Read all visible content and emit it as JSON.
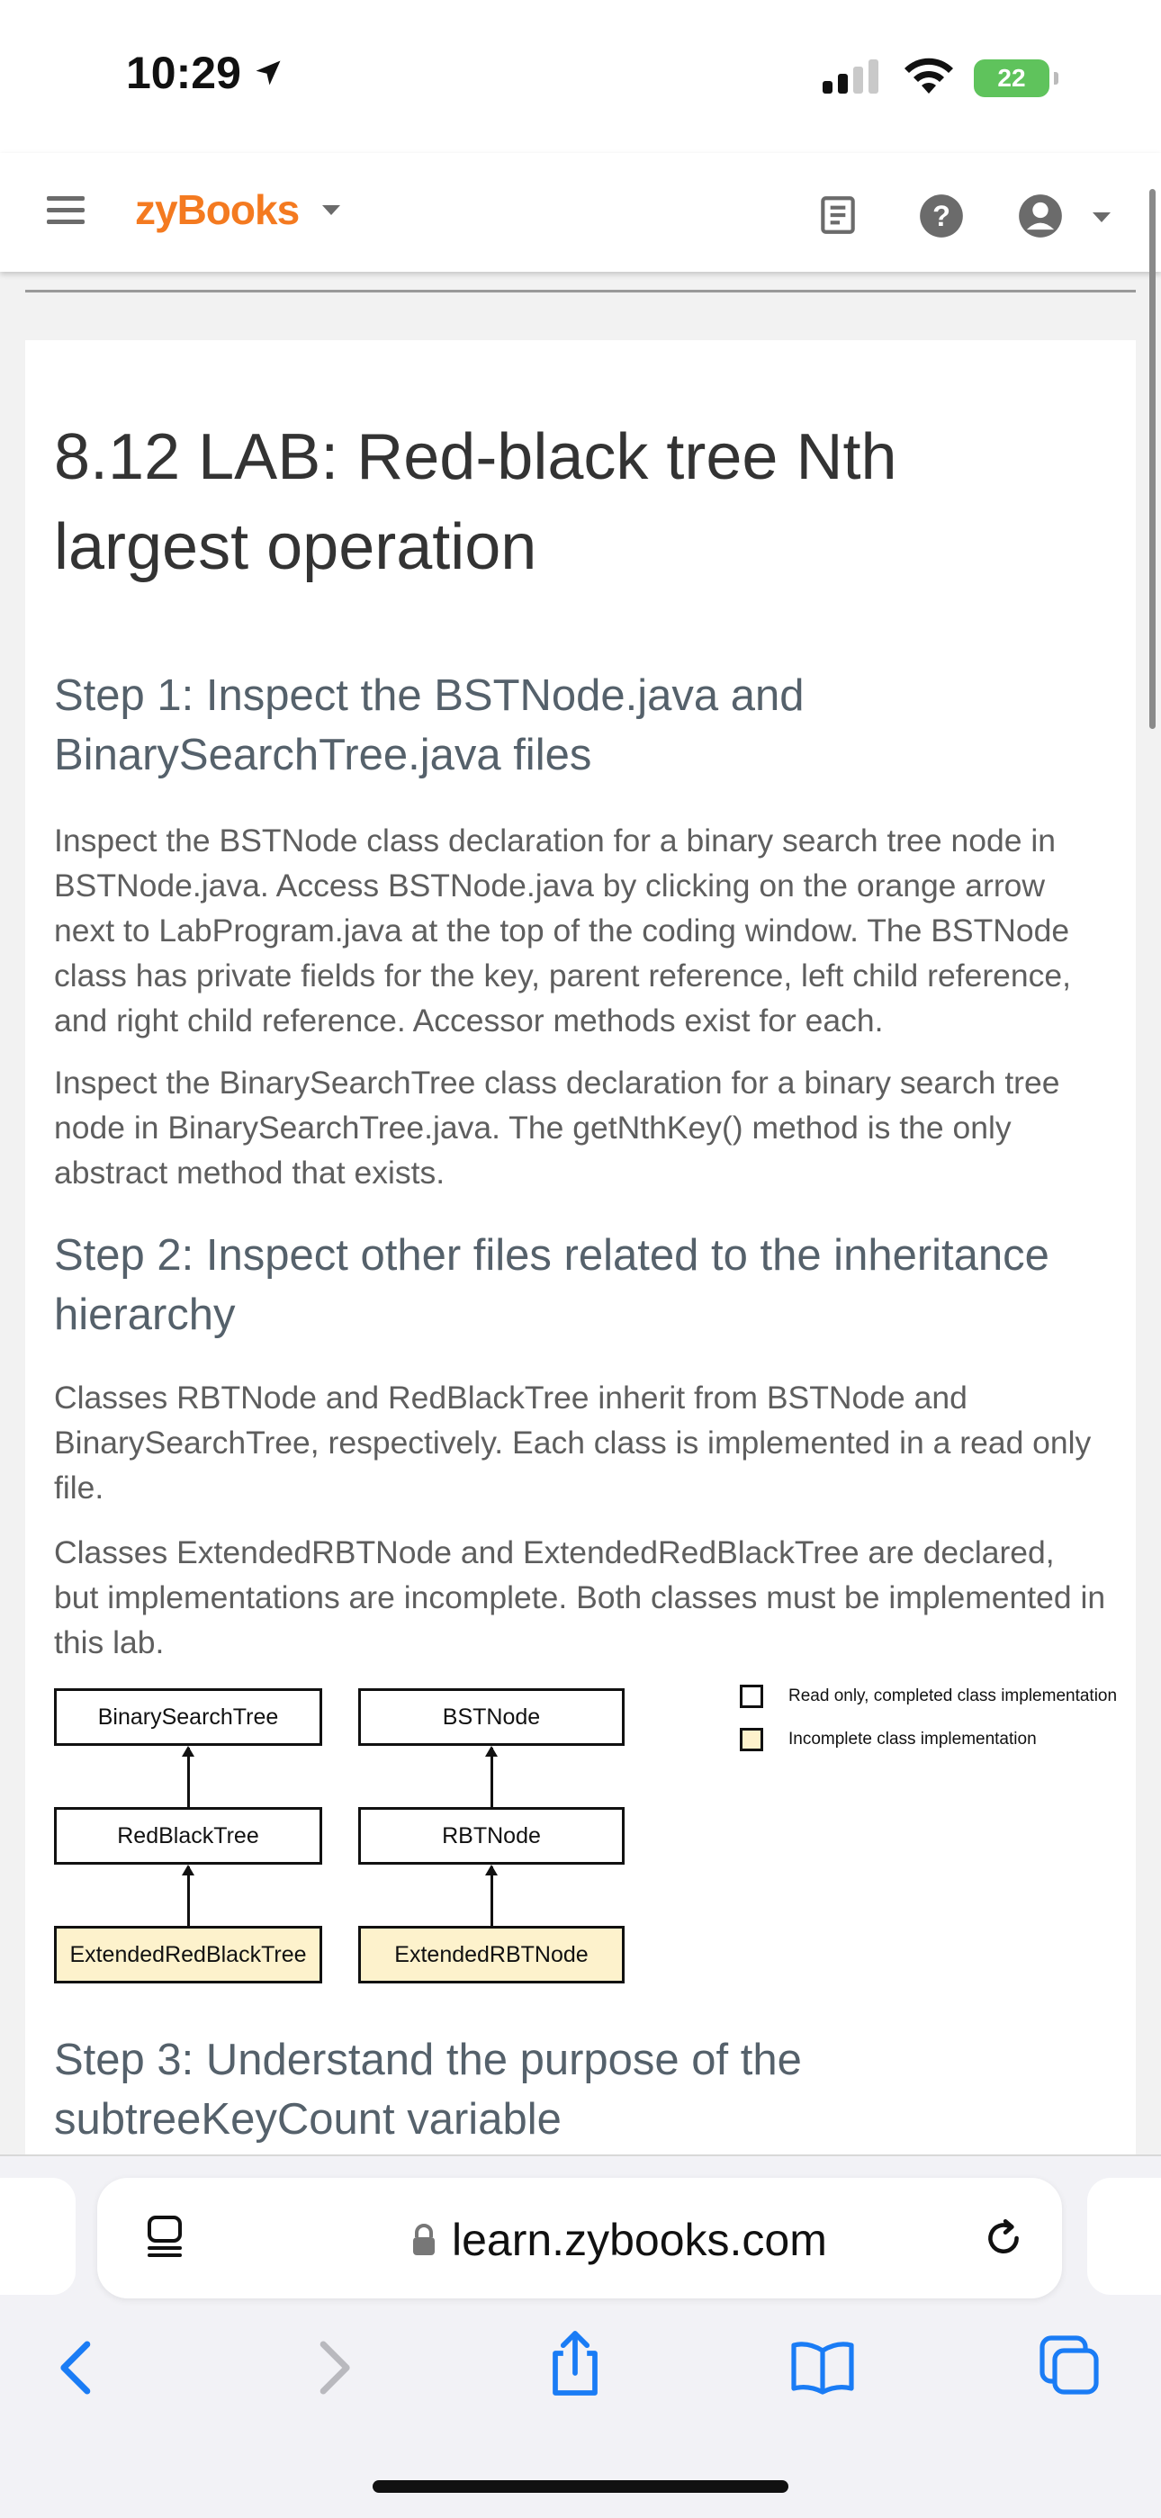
{
  "status_bar": {
    "time": "10:29",
    "battery": "22"
  },
  "header": {
    "brand": "zyBooks"
  },
  "page": {
    "title": "8.12 LAB: Red-black tree Nth largest operation",
    "step1": {
      "heading": "Step 1: Inspect the BSTNode.java and BinarySearchTree.java files",
      "para1": "Inspect the BSTNode class declaration for a binary search tree node in BSTNode.java. Access BSTNode.java by clicking on the orange arrow next to LabProgram.java at the top of the coding window. The BSTNode class has private fields for the key, parent reference, left child reference, and right child reference. Accessor methods exist for each.",
      "para2": "Inspect the BinarySearchTree class declaration for a binary search tree node in BinarySearchTree.java. The getNthKey() method is the only abstract method that exists."
    },
    "step2": {
      "heading": "Step 2: Inspect other files related to the inheritance hierarchy",
      "para1": "Classes RBTNode and RedBlackTree inherit from BSTNode and BinarySearchTree, respectively. Each class is implemented in a read only file.",
      "para2": "Classes ExtendedRBTNode and ExtendedRedBlackTree are declared, but implementations are incomplete. Both classes must be implemented in this lab."
    },
    "diagram": {
      "left_col": [
        "BinarySearchTree",
        "RedBlackTree",
        "ExtendedRedBlackTree"
      ],
      "right_col": [
        "BSTNode",
        "RBTNode",
        "ExtendedRBTNode"
      ],
      "legend": {
        "read_only": "Read only, completed class implementation",
        "incomplete": "Incomplete class implementation"
      },
      "colors": {
        "incomplete_fill": "#fdf2cc",
        "read_only_fill": "#ffffff"
      }
    },
    "step3": {
      "heading": "Step 3: Understand the purpose of the subtreeKeyCount variable"
    }
  },
  "browser": {
    "url": "learn.zybooks.com"
  },
  "icons": [
    "location-arrow-icon",
    "signal-icon",
    "wifi-icon",
    "battery-icon",
    "menu-icon",
    "chevron-down-icon",
    "book-icon",
    "help-icon",
    "user-icon",
    "tab-layout-icon",
    "lock-icon",
    "reload-icon",
    "back-icon",
    "forward-icon",
    "share-icon",
    "bookmarks-icon",
    "tabs-icon"
  ]
}
